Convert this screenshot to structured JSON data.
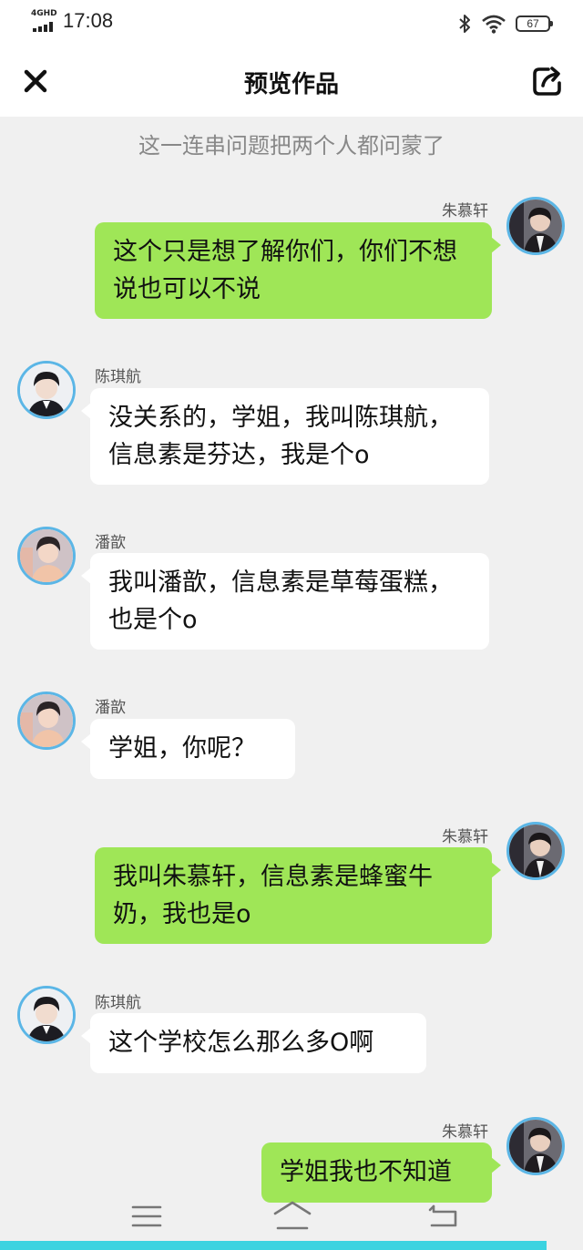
{
  "status": {
    "network": "4GHD",
    "time": "17:08",
    "battery": "67"
  },
  "nav": {
    "title": "预览作品"
  },
  "caption": "这一连串问题把两个人都问蒙了",
  "characters": {
    "zhu": {
      "name": "朱慕轩"
    },
    "chen": {
      "name": "陈琪航"
    },
    "pan": {
      "name": "潘歆"
    }
  },
  "messages": [
    {
      "speaker": "朱慕轩",
      "side": "right",
      "text": "这个只是想了解你们，你们不想说也可以不说"
    },
    {
      "speaker": "陈琪航",
      "side": "left",
      "text": "没关系的，学姐，我叫陈琪航，信息素是芬达，我是个o"
    },
    {
      "speaker": "潘歆",
      "side": "left",
      "text": "我叫潘歆，信息素是草莓蛋糕，也是个o"
    },
    {
      "speaker": "潘歆",
      "side": "left",
      "text": "学姐，你呢？"
    },
    {
      "speaker": "朱慕轩",
      "side": "right",
      "text": "我叫朱慕轩，信息素是蜂蜜牛奶，我也是o"
    },
    {
      "speaker": "陈琪航",
      "side": "left",
      "text": "这个学校怎么那么多O啊"
    },
    {
      "speaker": "朱慕轩",
      "side": "right",
      "text": "学姐我也不知道"
    }
  ],
  "colors": {
    "right_bubble": "#9fe657",
    "left_bubble": "#ffffff",
    "avatar_border": "#5bb6e6",
    "background": "#f0f0f0",
    "bottom_strip": "#3cd3e0"
  },
  "icons": {
    "close": "close-icon",
    "share": "share-icon",
    "menu": "menu-icon",
    "home": "home-icon",
    "back": "back-icon"
  }
}
